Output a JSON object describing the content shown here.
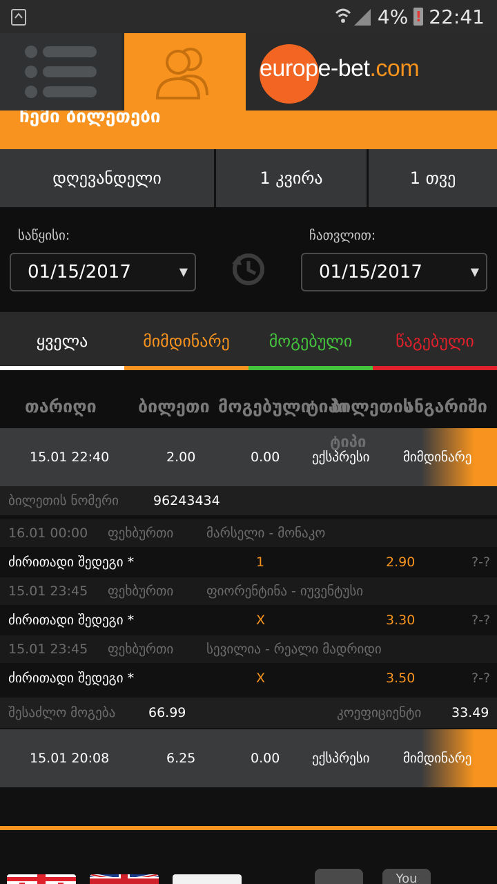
{
  "status_bar": {
    "battery": "4%",
    "time": "22:41"
  },
  "brand": {
    "logo_prefix": "euro",
    "logo_main": "pe-bet",
    "logo_suffix": ".com"
  },
  "page_title": "ჩემი ბილეთები",
  "range_tabs": [
    "დღევანდელი",
    "1 კვირა",
    "1 თვე"
  ],
  "dates": {
    "from_label": "საწყისი:",
    "from_value": "01/15/2017",
    "to_label": "ჩათვლით:",
    "to_value": "01/15/2017"
  },
  "status_tabs": [
    {
      "label": "ყველა",
      "color": "#ffffff"
    },
    {
      "label": "მიმდინარე",
      "color": "#f7931e"
    },
    {
      "label": "მოგებული",
      "color": "#43c43c"
    },
    {
      "label": "წაგებული",
      "color": "#e0202a"
    }
  ],
  "columns": [
    "თარიღი",
    "ბილეთი",
    "მოგებული",
    "ტიპი",
    "ბილეთის",
    "ანგარიში"
  ],
  "columns_overflow": "ტიპი",
  "tickets": [
    {
      "date": "15.01 22:40",
      "amount": "2.00",
      "win": "0.00",
      "type": "ექსპრესი",
      "status": "მიმდინარე",
      "number_label": "ბილეთის ნომერი",
      "number": "96243434",
      "events": [
        {
          "datetime": "16.01 00:00",
          "sport": "ფეხბურთი",
          "match": "მარსელი - მონაკო",
          "market": "ძირითადი შედეგი *",
          "pick": "1",
          "odds": "2.90",
          "score": "?-?"
        },
        {
          "datetime": "15.01 23:45",
          "sport": "ფეხბურთი",
          "match": "ფიორენტინა - იუვენტუსი",
          "market": "ძირითადი შედეგი *",
          "pick": "X",
          "odds": "3.30",
          "score": "?-?"
        },
        {
          "datetime": "15.01 23:45",
          "sport": "ფეხბურთი",
          "match": "სევილია - რეალი მადრიდი",
          "market": "ძირითადი შედეგი *",
          "pick": "X",
          "odds": "3.50",
          "score": "?-?"
        }
      ],
      "possible_win_label": "შესაძლო მოგება",
      "possible_win": "66.99",
      "coef_label": "კოეფიციენტი",
      "coef": "33.49"
    },
    {
      "date": "15.01 20:08",
      "amount": "6.25",
      "win": "0.00",
      "type": "ექსპრესი",
      "status": "მიმდინარე"
    }
  ],
  "footer": {
    "social": [
      "You"
    ]
  }
}
